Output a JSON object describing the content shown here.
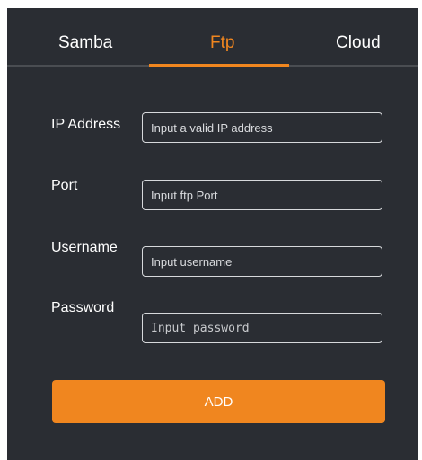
{
  "tabs": [
    {
      "label": "Samba"
    },
    {
      "label": "Ftp",
      "active": true
    },
    {
      "label": "Cloud"
    }
  ],
  "form": {
    "ip": {
      "label": "IP Address",
      "placeholder": "Input a valid IP address",
      "value": ""
    },
    "port": {
      "label": "Port",
      "placeholder": "Input ftp Port",
      "value": ""
    },
    "username": {
      "label": "Username",
      "placeholder": "Input username",
      "value": ""
    },
    "password": {
      "label": "Password",
      "placeholder": "Input password",
      "value": ""
    }
  },
  "add_button": {
    "label": "ADD"
  },
  "colors": {
    "accent": "#f0861f",
    "background": "#2a2d33",
    "divider": "#4a4d52"
  }
}
